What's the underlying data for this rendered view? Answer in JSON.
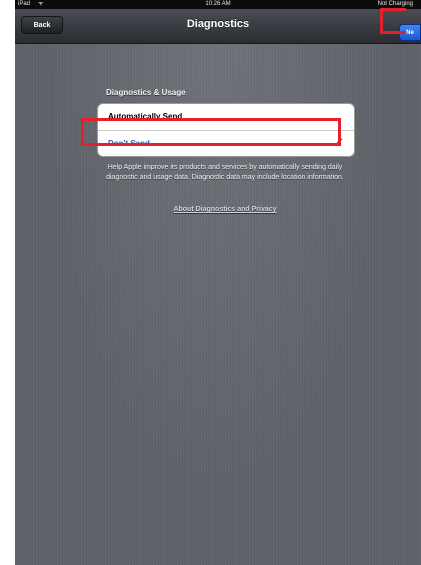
{
  "status_bar": {
    "device": "iPad",
    "time": "10:26 AM",
    "battery": "Not Charging"
  },
  "nav": {
    "back_label": "Back",
    "title": "Diagnostics",
    "next_label": "Ne"
  },
  "section": {
    "header": "Diagnostics & Usage",
    "options": [
      {
        "label": "Automatically Send",
        "selected": false
      },
      {
        "label": "Don't Send",
        "selected": true
      }
    ],
    "check": "✓"
  },
  "footer": {
    "text": "Help Apple improve its products and services by automatically sending daily diagnostic and usage data. Diagnostic data may include location information.",
    "link": "About Diagnostics and Privacy"
  },
  "colors": {
    "highlight": "#e5202a",
    "selected_text": "#365f9c"
  }
}
